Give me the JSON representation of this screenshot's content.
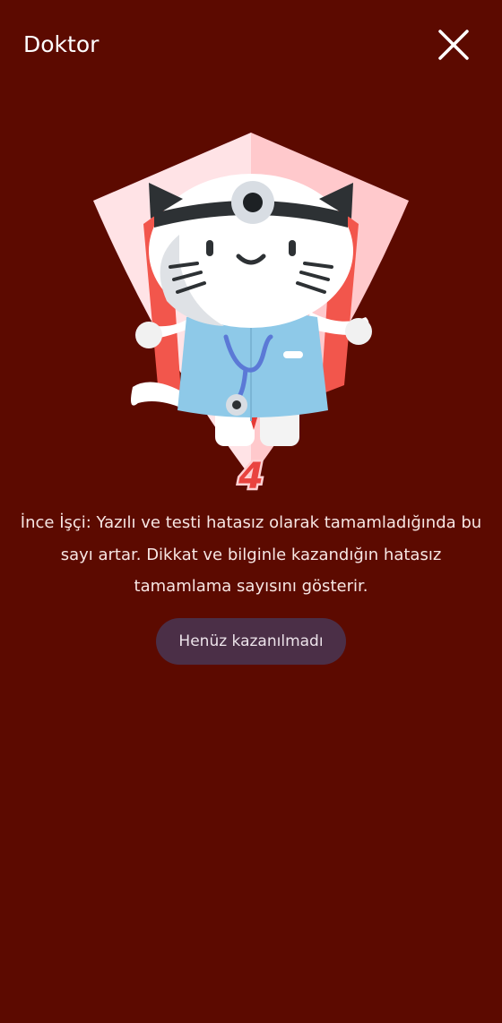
{
  "header": {
    "title": "Doktor"
  },
  "badge": {
    "level": "4"
  },
  "description": "İnce İşçi: Yazılı ve testi hatasız olarak tamamladığında bu sayı artar. Dikkat ve bilginle kazandığın hatasız tamamlama sayısını gösterir.",
  "status": {
    "label": "Henüz kazanılmadı"
  },
  "colors": {
    "background": "#5c0a00",
    "badge_left": "#ffe3e6",
    "badge_right": "#ffc9cc",
    "status_pill": "#4b2f47",
    "coat": "#8ec9e8"
  }
}
